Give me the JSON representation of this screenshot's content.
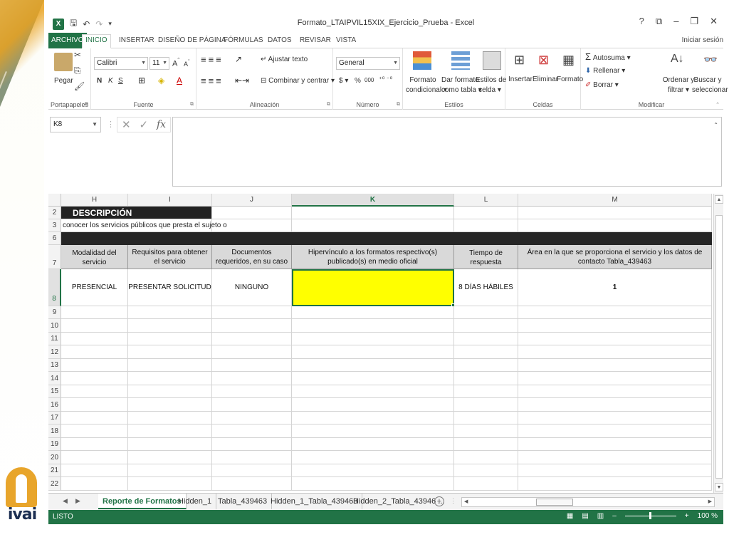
{
  "window": {
    "title": "Formato_LTAIPVIL15XIX_Ejercicio_Prueba - Excel",
    "sign_in": "Iniciar sesión",
    "controls": [
      "?",
      "⧉",
      "–",
      "🗗",
      "✕"
    ]
  },
  "ribbon_tabs": [
    "ARCHIVO",
    "INICIO",
    "INSERTAR",
    "DISEÑO DE PÁGINA",
    "FÓRMULAS",
    "DATOS",
    "REVISAR",
    "VISTA"
  ],
  "ribbon": {
    "clipboard": {
      "label": "Portapapeles",
      "paste": "Pegar"
    },
    "font": {
      "label": "Fuente",
      "name": "Calibri",
      "size": "11",
      "bold": "N",
      "italic": "K",
      "underline": "S"
    },
    "alignment": {
      "label": "Alineación",
      "wrap": "Ajustar texto",
      "merge": "Combinar y centrar"
    },
    "number": {
      "label": "Número",
      "format": "General",
      "currency": "$",
      "percent": "%",
      "thousands": "000"
    },
    "styles": {
      "label": "Estilos",
      "conditional": [
        "Formato",
        "condicional"
      ],
      "as_table": [
        "Dar formato",
        "como tabla"
      ],
      "cell_styles": [
        "Estilos de",
        "celda"
      ]
    },
    "cells": {
      "label": "Celdas",
      "insert": "Insertar",
      "delete": "Eliminar",
      "format": "Formato"
    },
    "editing": {
      "label": "Modificar",
      "autosum": "Autosuma",
      "fill": "Rellenar",
      "clear": "Borrar",
      "sort": [
        "Ordenar y",
        "filtrar"
      ],
      "find": [
        "Buscar y",
        "seleccionar"
      ]
    }
  },
  "formula_bar": {
    "name_box": "K8",
    "value": ""
  },
  "grid": {
    "columns": [
      "H",
      "I",
      "J",
      "K",
      "L",
      "M"
    ],
    "selected_column": "K",
    "rows": [
      "2",
      "3",
      "6",
      "7",
      "8",
      "9",
      "10",
      "11",
      "12",
      "13",
      "14",
      "15",
      "16",
      "17",
      "18",
      "19",
      "20",
      "21",
      "22"
    ],
    "selected_row": "8",
    "description_label": "DESCRIPCIÓN",
    "row3_text": "conocer los servicios públicos que presta el sujeto o",
    "headers": [
      "Modalidad del servicio",
      "Requisitos para obtener el servicio",
      "Documentos requeridos, en su caso",
      "Hipervínculo a los formatos respectivo(s) publicado(s) en medio oficial",
      "Tiempo de respuesta",
      "Área en la que se proporciona el servicio y los datos de contacto Tabla_439463"
    ],
    "values": [
      "PRESENCIAL",
      "PRESENTAR SOLICITUD",
      "NINGUNO",
      "",
      "8 DÍAS HÁBILES",
      "1"
    ]
  },
  "sheets": [
    "Reporte de Formatos",
    "Hidden_1",
    "Tabla_439463",
    "Hidden_1_Tabla_439463",
    "Hidden_2_Tabla_43946 ..."
  ],
  "active_sheet": "Reporte de Formatos",
  "status": {
    "mode": "LISTO",
    "zoom": "100 %"
  },
  "logo": {
    "text": "ivai"
  },
  "colors": {
    "excel_green": "#217346",
    "highlight_yellow": "#ffff00",
    "header_gray": "#d9d9d9",
    "desc_black": "#222222"
  }
}
